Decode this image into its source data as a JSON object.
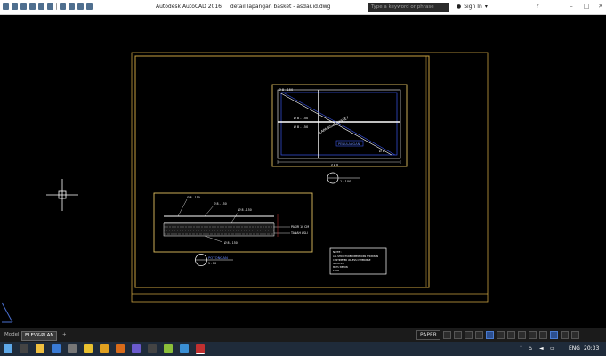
{
  "title_bar": {
    "app_title": "Autodesk AutoCAD 2016",
    "file_title": "detail lapangan basket - asdar.id.dwg",
    "search_placeholder": "Type a keyword or phrase",
    "sign_in_label": "Sign In"
  },
  "drawing": {
    "plan_top_label": "Ø 8 - 150",
    "plan_mid_label_1": "Ø 8 - 150",
    "plan_mid_label_2": "Ø 8 - 150",
    "plan_diag_label": "LAPANGAN BASKET",
    "plan_blue_label": "PENULANGAN",
    "plan_right_label": "Ø 8",
    "plan_dim_bottom": "2 Ø 6",
    "section_label_1": "Ø 8 - 150",
    "section_label_2": "Ø 8 - 150",
    "section_label_3": "Ø 8 - 150",
    "section_right_1": "PASIR 10 CM",
    "section_right_2": "TANAH ASLI",
    "section_bottom_label": "Ø 8 - 150",
    "section_title": "POTONGAN",
    "section_scale": "1 : 20",
    "plan_title_scale": "1 : 100",
    "notes_title": "NOTE :",
    "notes_line_1": "ALL STRUCTURE DIMENSIONS SHOWN IN",
    "notes_line_2": "CENTIMETER UNLESS OTHERWISE",
    "notes_line_3": "SPECIFIED",
    "notes_line_4": "MUTU BETON",
    "notes_line_5": "K-225"
  },
  "tabs": {
    "model": "Model",
    "layout": "ELEV&PLAN",
    "add": "+"
  },
  "status": {
    "paper_label": "PAPER"
  },
  "taskbar": {
    "lang": "ENG",
    "time": "20:33"
  }
}
